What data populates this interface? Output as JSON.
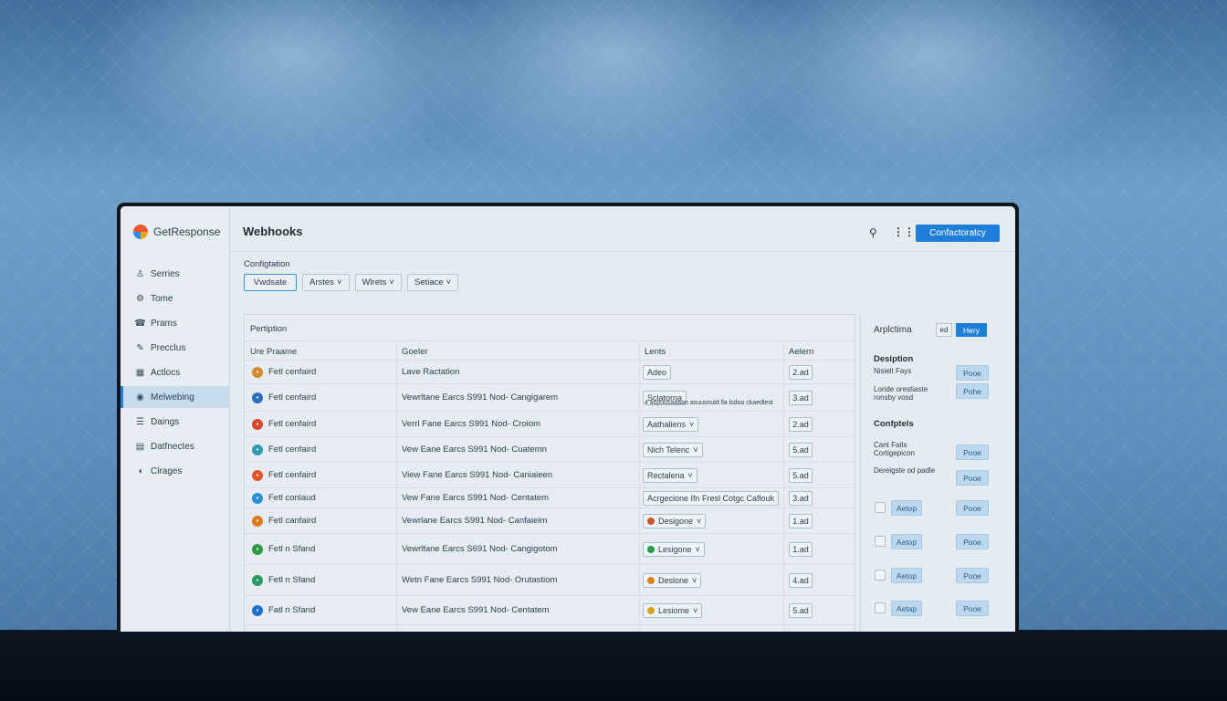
{
  "app": {
    "brand": "GetResponse"
  },
  "sidebar": {
    "items": [
      {
        "label": "Serries",
        "icon": "user-icon"
      },
      {
        "label": "Tome",
        "icon": "gear-icon"
      },
      {
        "label": "Prams",
        "icon": "phone-icon"
      },
      {
        "label": "Precclus",
        "icon": "edit-icon"
      },
      {
        "label": "Actlocs",
        "icon": "grid-icon"
      },
      {
        "label": "Melwebing",
        "icon": "webhook-icon",
        "active": true
      },
      {
        "label": "Daings",
        "icon": "list-icon"
      },
      {
        "label": "Datfnectes",
        "icon": "document-icon"
      },
      {
        "label": "Clrages",
        "icon": "shield-icon"
      }
    ]
  },
  "header": {
    "title": "Webhooks",
    "primary_button": "Confactoratcy"
  },
  "config": {
    "label": "Configtation",
    "filters": [
      {
        "label": "Vwdsate",
        "dropdown": false
      },
      {
        "label": "Arstes",
        "dropdown": true
      },
      {
        "label": "Wlrets",
        "dropdown": true
      },
      {
        "label": "Setiace",
        "dropdown": true
      }
    ]
  },
  "table": {
    "title": "Pertiption",
    "columns": [
      "Ure Praame",
      "Goeler",
      "Lents",
      "Aelern"
    ],
    "rows": [
      {
        "name": "Fetl cenfaird",
        "goeler": "Lave Ractation",
        "select": "Adeo",
        "select_dropdown": false,
        "value": "2.ad",
        "icon_color": "#d68a2a"
      },
      {
        "name": "Fetl cenfaird",
        "goeler": "Vewrltane Earcs S991 Nod- Cangigarem",
        "select": "Sclatorna",
        "select_extra": "4 aspuusaaaan asuusnuld lla lsdoo ckaedlest",
        "select_dropdown": false,
        "value": "3.ad",
        "icon_color": "#2b6fb8"
      },
      {
        "name": "Fetl cenfaird",
        "goeler": "Verrl Fane Earcs S991 Nod- Croiom",
        "select": "Aathaliens",
        "select_dropdown": true,
        "value": "2.ad",
        "icon_color": "#d9452b"
      },
      {
        "name": "Fetl cenfaird",
        "goeler": "Vew Eane Earcs S991 Nod- Cuatemn",
        "select": "Nich Telenc",
        "select_dropdown": true,
        "value": "5.ad",
        "icon_color": "#2a9bb0"
      },
      {
        "name": "Fetl cenfaird",
        "goeler": "View Fane Earcs S991 Nod- Caniaieen",
        "select": "Rectalena",
        "select_dropdown": true,
        "value": "5.ad",
        "icon_color": "#e0562a"
      },
      {
        "name": "Fetl conlaud",
        "goeler": "Vew Fane Earcs S991 Nod- Centatem",
        "select": "Acrgecione Ifn Fresl Cotgc Caflouk",
        "select_dropdown": false,
        "value": "3.ad",
        "icon_color": "#2a8fd6"
      },
      {
        "name": "Fetl canfaird",
        "goeler": "Vewrlane Earcs S991 Nod- Canfaieim",
        "select": "Desigone",
        "select_dropdown": true,
        "select_dot": "#c9552a",
        "value": "1.ad",
        "icon_color": "#e07a1f"
      },
      {
        "name": "Fetl n Sfand",
        "goeler": "Vewrlfane Earcs S691 Nod- Cangigotom",
        "select": "Lesigone",
        "select_dropdown": true,
        "select_dot": "#2a9a4a",
        "value": "1.ad",
        "icon_color": "#2e9b45"
      },
      {
        "name": "Fetl n Sfand",
        "goeler": "Wetn Fane Earcs S991 Nod- Orutastiom",
        "select": "Deslone",
        "select_dropdown": true,
        "select_dot": "#d9831f",
        "value": "4.ad",
        "icon_color": "#2a9a5e"
      },
      {
        "name": "Fatl n Sfand",
        "goeler": "Vew Eane Earcs S991 Nod- Centatem",
        "select": "Lesiome",
        "select_dropdown": true,
        "select_dot": "#d9a21f",
        "value": "5.ad",
        "icon_color": "#1f6fd0"
      }
    ]
  },
  "right_panel": {
    "title": "Arplctima",
    "toggle_a": "ed",
    "toggle_b": "Hery",
    "description_heading": "Desiption",
    "desc_items": [
      {
        "text": "Nisielt Fays",
        "button": "Pooe"
      },
      {
        "text": "Loride orestiaste ronsby vosd",
        "button": "Pohe"
      }
    ],
    "config_heading": "Confptels",
    "config_items": [
      {
        "text": "Cant Fatls Cortigepicon",
        "button": "Pooe"
      },
      {
        "text": "Dereigste od padle",
        "button": "Pooe"
      }
    ],
    "check_rows": [
      {
        "button_a": "Aetop",
        "button_b": "Pooe"
      },
      {
        "button_a": "Aetop",
        "button_b": "Pooe"
      },
      {
        "button_a": "Aetop",
        "button_b": "Pooe"
      },
      {
        "button_a": "Aetap",
        "button_b": "Pooe"
      }
    ]
  }
}
